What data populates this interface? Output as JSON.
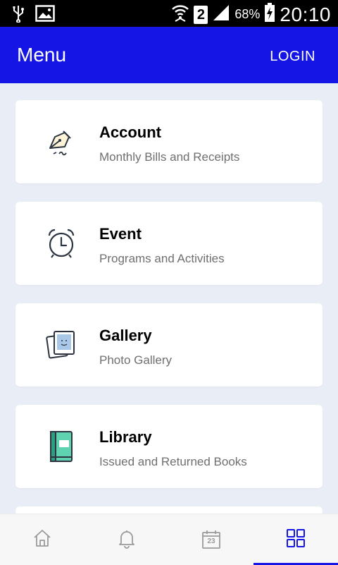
{
  "status_bar": {
    "sim": "2",
    "battery": "68%",
    "time": "20:10"
  },
  "app_bar": {
    "title": "Menu",
    "login_label": "LOGIN"
  },
  "menu": [
    {
      "title": "Account",
      "subtitle": "Monthly Bills and Receipts",
      "icon": "pen-nib-icon"
    },
    {
      "title": "Event",
      "subtitle": "Programs and Activities",
      "icon": "alarm-clock-icon"
    },
    {
      "title": "Gallery",
      "subtitle": "Photo Gallery",
      "icon": "photo-gallery-icon"
    },
    {
      "title": "Library",
      "subtitle": "Issued and Returned Books",
      "icon": "book-icon"
    }
  ],
  "bottom_nav": {
    "calendar_day": "23",
    "items": [
      "home-icon",
      "bell-icon",
      "calendar-icon",
      "grid-icon"
    ],
    "active": "grid-icon"
  },
  "colors": {
    "accent": "#1515e6",
    "background": "#e8edf6",
    "library_icon": "#5fd3b0"
  }
}
